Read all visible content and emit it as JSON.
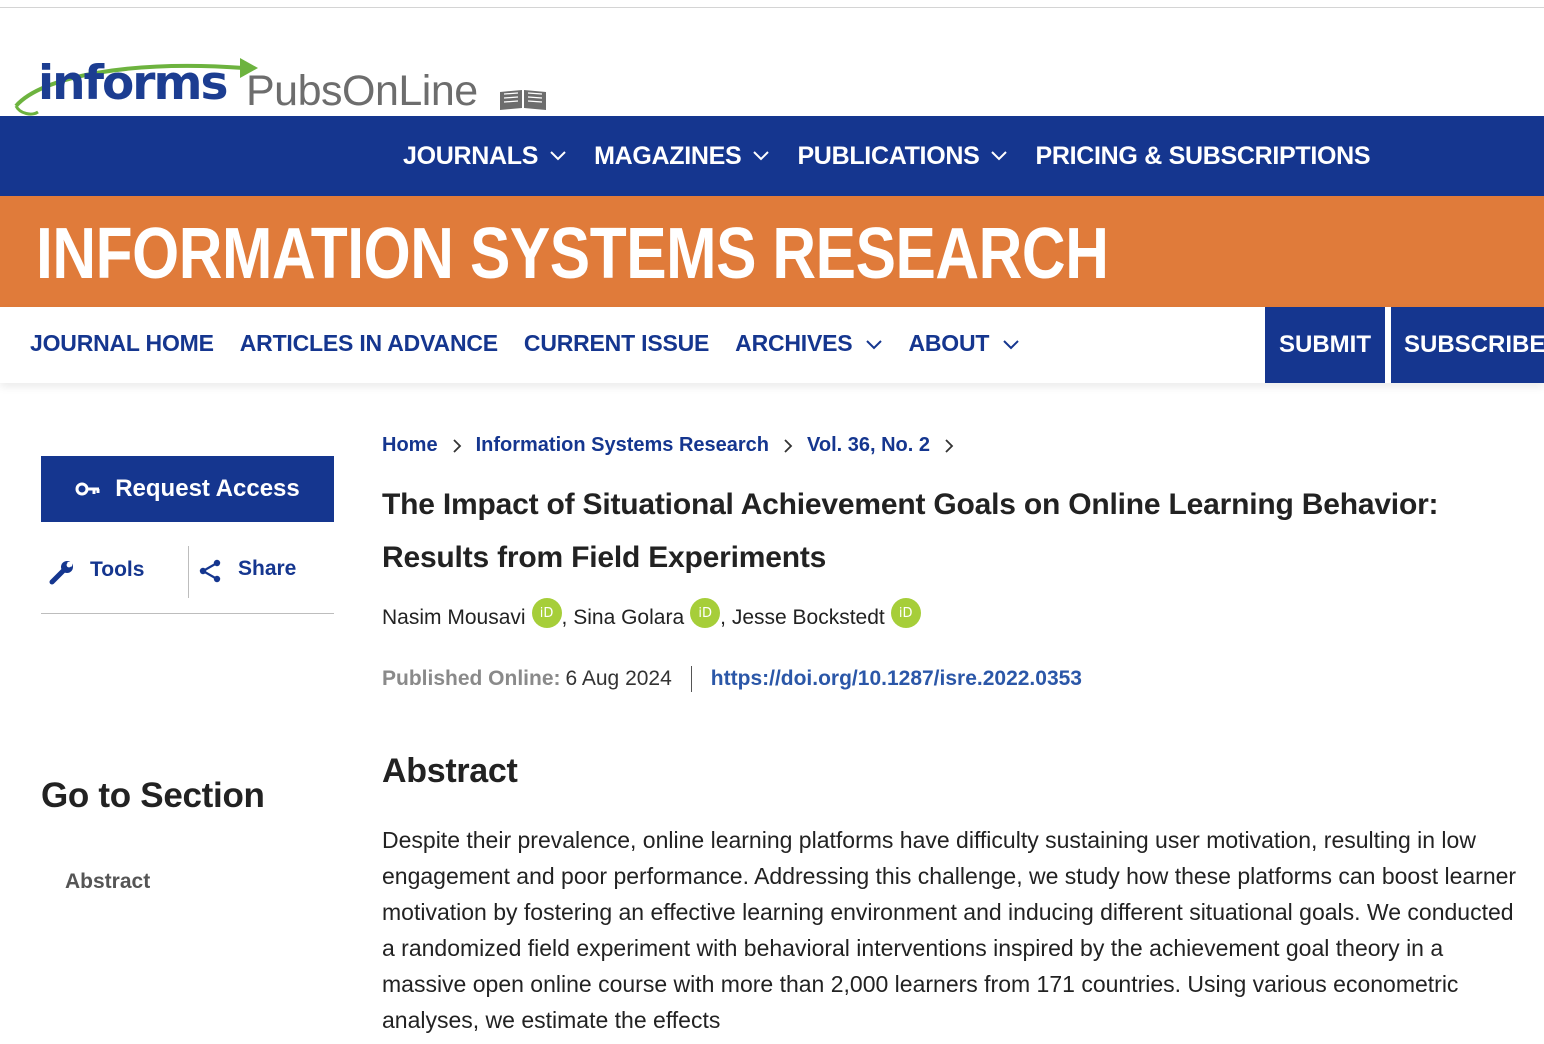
{
  "logo": {
    "brand": "informs",
    "product": "PubsOnLine",
    "book_icon": "open-book-icon",
    "brand_color": "#1c3d91",
    "accent_color": "#6db33f"
  },
  "main_nav": {
    "items": [
      {
        "label": "JOURNALS",
        "has_dropdown": true
      },
      {
        "label": "MAGAZINES",
        "has_dropdown": true
      },
      {
        "label": "PUBLICATIONS",
        "has_dropdown": true
      },
      {
        "label": "PRICING & SUBSCRIPTIONS",
        "has_dropdown": false
      }
    ],
    "background": "#15368f"
  },
  "banner": {
    "title": "INFORMATION SYSTEMS RESEARCH",
    "background": "#e07b3a"
  },
  "journal_nav": {
    "items": [
      {
        "label": "JOURNAL HOME",
        "has_dropdown": false
      },
      {
        "label": "ARTICLES IN ADVANCE",
        "has_dropdown": false
      },
      {
        "label": "CURRENT ISSUE",
        "has_dropdown": false
      },
      {
        "label": "ARCHIVES",
        "has_dropdown": true
      },
      {
        "label": "ABOUT",
        "has_dropdown": true
      }
    ],
    "submit_label": "SUBMIT",
    "subscribe_label": "SUBSCRIBE"
  },
  "sidebar": {
    "request_access_label": "Request Access",
    "tools_label": "Tools",
    "share_label": "Share",
    "goto_title": "Go to Section",
    "sections": [
      "Abstract"
    ]
  },
  "breadcrumb": [
    "Home",
    "Information Systems Research",
    "Vol. 36, No. 2"
  ],
  "article": {
    "title": "The Impact of Situational Achievement Goals on Online Learning Behavior: Results from Field Experiments",
    "authors": [
      "Nasim Mousavi",
      "Sina Golara",
      "Jesse Bockstedt"
    ],
    "author_separator": ",",
    "orcid_label": "iD",
    "published_label": "Published Online:",
    "published_date": "6 Aug 2024",
    "doi": "https://doi.org/10.1287/isre.2022.0353",
    "abstract_heading": "Abstract",
    "abstract_text": "Despite their prevalence, online learning platforms have difficulty sustaining user motivation, resulting in low engagement and poor performance. Addressing this challenge, we study how these platforms can boost learner motivation by fostering an effective learning environment and inducing different situational goals. We conducted a randomized field experiment with behavioral interventions inspired by the achievement goal theory in a massive open online course with more than 2,000 learners from 171 countries. Using various econometric analyses, we estimate the effects"
  }
}
